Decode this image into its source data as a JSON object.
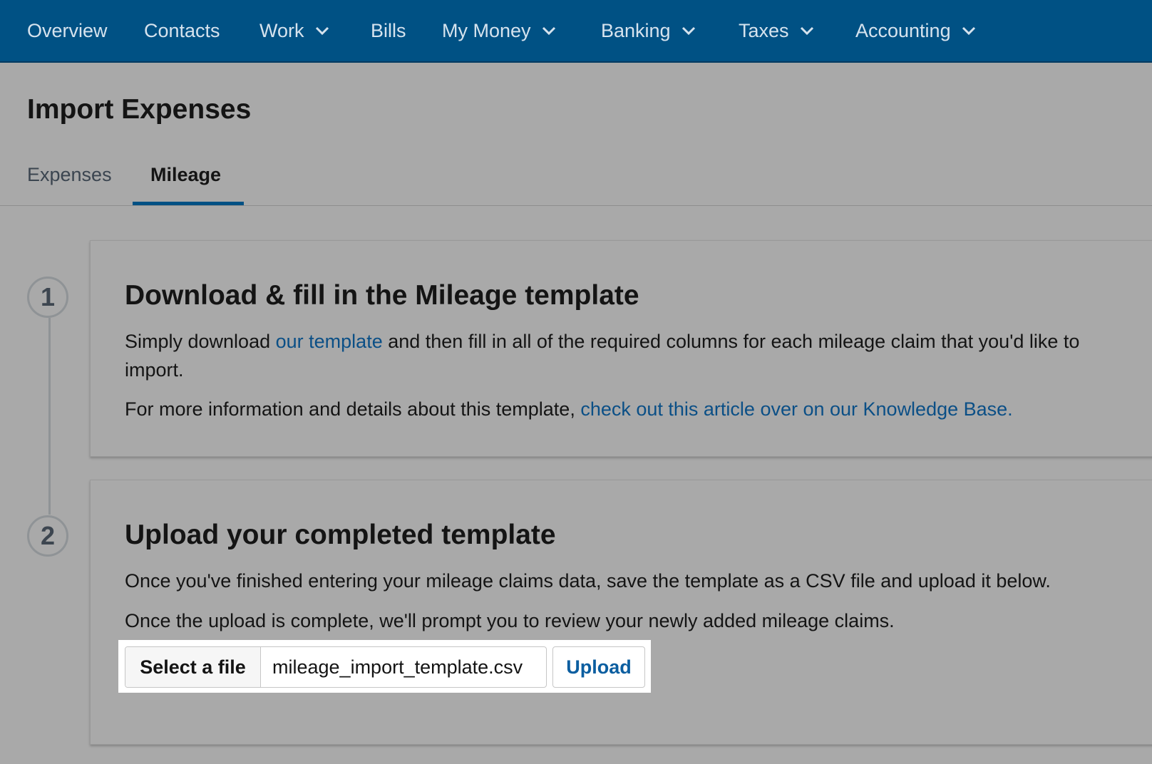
{
  "nav": {
    "items": [
      {
        "label": "Overview",
        "dropdown": false
      },
      {
        "label": "Contacts",
        "dropdown": false
      },
      {
        "label": "Work",
        "dropdown": true
      },
      {
        "label": "Bills",
        "dropdown": false
      },
      {
        "label": "My Money",
        "dropdown": true
      },
      {
        "label": "Banking",
        "dropdown": true
      },
      {
        "label": "Taxes",
        "dropdown": true
      },
      {
        "label": "Accounting",
        "dropdown": true
      }
    ]
  },
  "page": {
    "title": "Import Expenses"
  },
  "tabs": [
    {
      "label": "Expenses",
      "active": false
    },
    {
      "label": "Mileage",
      "active": true
    }
  ],
  "steps": [
    {
      "number": "1",
      "title": "Download & fill in the Mileage template",
      "para1_before": "Simply download ",
      "para1_link": "our template",
      "para1_after": " and then fill in all of the required columns for each mileage claim that you'd like to import.",
      "para2_before": "For more information and details about this template, ",
      "para2_link": "check out this article over on our Knowledge Base."
    },
    {
      "number": "2",
      "title": "Upload your completed template",
      "para1": "Once you've finished entering your mileage claims data, save the template as a CSV file and upload it below.",
      "para2": "Once the upload is complete, we'll prompt you to review your newly added mileage claims."
    }
  ],
  "upload": {
    "select_label": "Select a file",
    "file_name": "mileage_import_template.csv",
    "upload_label": "Upload"
  },
  "colors": {
    "nav_bg": "#005184",
    "nav_text": "#d6e3ee",
    "link": "#0b4f86",
    "tab_active": "#005184"
  }
}
